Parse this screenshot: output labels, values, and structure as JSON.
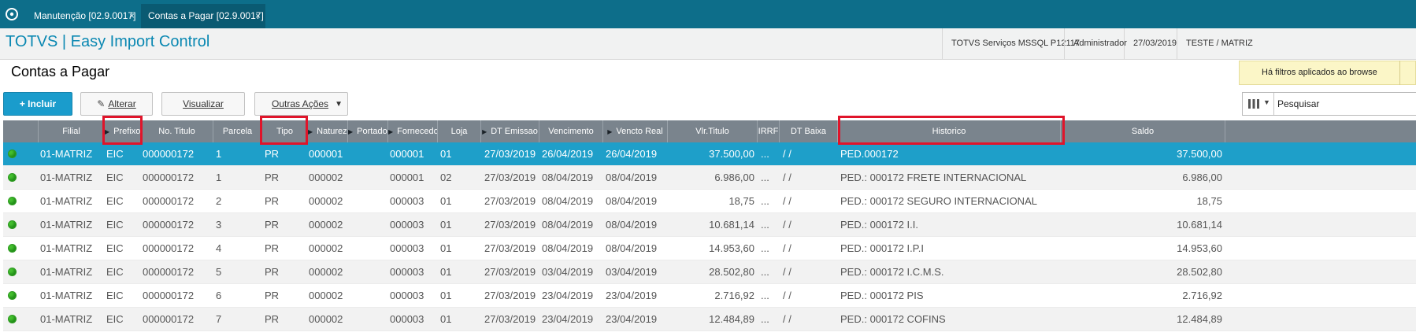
{
  "tabs": [
    {
      "label": "Manutenção [02.9.0017]",
      "close": "×"
    },
    {
      "label": "Contas a Pagar [02.9.0017]",
      "close": "×"
    }
  ],
  "app": {
    "title": "TOTVS | Easy Import Control",
    "status": [
      "TOTVS Serviços MSSQL P12117",
      "Administrador",
      "27/03/2019",
      "TESTE / MATRIZ"
    ]
  },
  "page": {
    "title": "Contas a Pagar",
    "filter_notice": "Há filtros aplicados ao browse"
  },
  "toolbar": {
    "incluir": "+ Incluir",
    "alterar": "Alterar",
    "visualizar": "Visualizar",
    "outras": "Outras Ações"
  },
  "search": {
    "placeholder": "Pesquisar"
  },
  "colors": {
    "header": "#7a848d",
    "selected": "#1e9fc9",
    "accent": "#0a88b2",
    "highlight": "#e0142a",
    "status_ok": "#45c12f"
  },
  "grid": {
    "columns": [
      "Filial",
      "Prefixo",
      "No. Titulo",
      "Parcela",
      "Tipo",
      "Natureza",
      "Portador",
      "Fornecedor",
      "Loja",
      "DT Emissao",
      "Vencimento",
      "Vencto Real",
      "Vlr.Titulo",
      "IRRF",
      "DT Baixa",
      "Historico",
      "Saldo"
    ],
    "rows": [
      [
        "01-MATRIZ",
        "EIC",
        "000000172",
        "1",
        "PR",
        "000001",
        "",
        "000001",
        "01",
        "27/03/2019",
        "26/04/2019",
        "26/04/2019",
        "37.500,00",
        "...",
        " /  /",
        "PED.000172",
        "37.500,00"
      ],
      [
        "01-MATRIZ",
        "EIC",
        "000000172",
        "1",
        "PR",
        "000002",
        "",
        "000001",
        "02",
        "27/03/2019",
        "08/04/2019",
        "08/04/2019",
        "6.986,00",
        "...",
        " /  /",
        "PED.: 000172 FRETE INTERNACIONAL",
        "6.986,00"
      ],
      [
        "01-MATRIZ",
        "EIC",
        "000000172",
        "2",
        "PR",
        "000002",
        "",
        "000003",
        "01",
        "27/03/2019",
        "08/04/2019",
        "08/04/2019",
        "18,75",
        "...",
        " /  /",
        "PED.: 000172 SEGURO INTERNACIONAL",
        "18,75"
      ],
      [
        "01-MATRIZ",
        "EIC",
        "000000172",
        "3",
        "PR",
        "000002",
        "",
        "000003",
        "01",
        "27/03/2019",
        "08/04/2019",
        "08/04/2019",
        "10.681,14",
        "...",
        " /  /",
        "PED.: 000172 I.I.",
        "10.681,14"
      ],
      [
        "01-MATRIZ",
        "EIC",
        "000000172",
        "4",
        "PR",
        "000002",
        "",
        "000003",
        "01",
        "27/03/2019",
        "08/04/2019",
        "08/04/2019",
        "14.953,60",
        "...",
        " /  /",
        "PED.: 000172 I.P.I",
        "14.953,60"
      ],
      [
        "01-MATRIZ",
        "EIC",
        "000000172",
        "5",
        "PR",
        "000002",
        "",
        "000003",
        "01",
        "27/03/2019",
        "03/04/2019",
        "03/04/2019",
        "28.502,80",
        "...",
        " /  /",
        "PED.: 000172 I.C.M.S.",
        "28.502,80"
      ],
      [
        "01-MATRIZ",
        "EIC",
        "000000172",
        "6",
        "PR",
        "000002",
        "",
        "000003",
        "01",
        "27/03/2019",
        "23/04/2019",
        "23/04/2019",
        "2.716,92",
        "...",
        " /  /",
        "PED.: 000172 PIS",
        "2.716,92"
      ],
      [
        "01-MATRIZ",
        "EIC",
        "000000172",
        "7",
        "PR",
        "000002",
        "",
        "000003",
        "01",
        "27/03/2019",
        "23/04/2019",
        "23/04/2019",
        "12.484,89",
        "...",
        " /  /",
        "PED.: 000172 COFINS",
        "12.484,89"
      ]
    ]
  }
}
